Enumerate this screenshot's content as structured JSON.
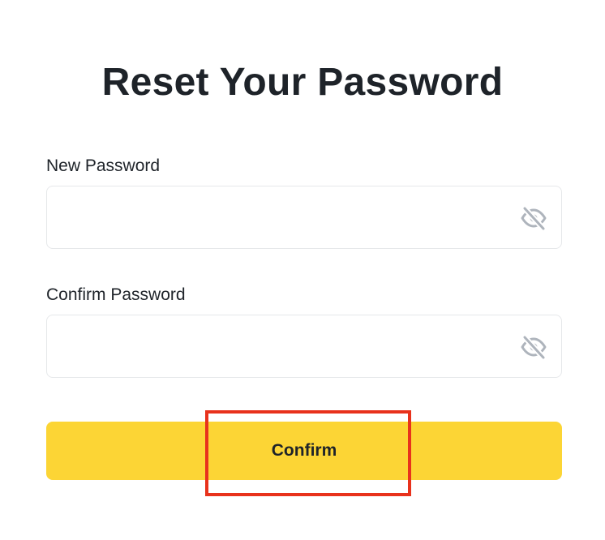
{
  "page": {
    "title": "Reset Your Password"
  },
  "form": {
    "new_password": {
      "label": "New Password",
      "value": "",
      "placeholder": "",
      "toggle_icon": "eye-slash-icon"
    },
    "confirm_password": {
      "label": "Confirm Password",
      "value": "",
      "placeholder": "",
      "toggle_icon": "eye-slash-icon"
    },
    "submit_label": "Confirm"
  },
  "colors": {
    "accent": "#fcd535",
    "text": "#1e2329",
    "field_border": "#e6e8ea",
    "icon": "#aeb4bc",
    "highlight_box": "#e8321c"
  }
}
